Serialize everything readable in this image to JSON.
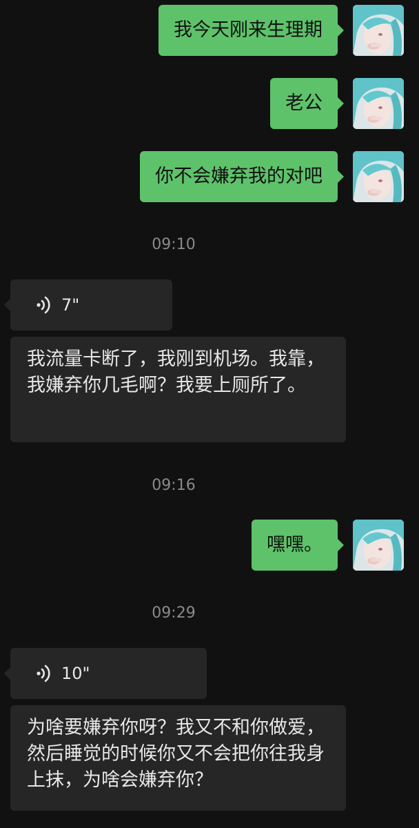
{
  "messages": {
    "out1": "我今天刚来生理期",
    "out2": "老公",
    "out3": "你不会嫌弃我的对吧",
    "out4": "嘿嘿。"
  },
  "timestamps": {
    "t1": "09:10",
    "t2": "09:16",
    "t3": "09:29"
  },
  "voice1": {
    "duration": "7\"",
    "transcript": "我流量卡断了，我刚到机场。我靠，我嫌弃你几毛啊？我要上厕所了。"
  },
  "voice2": {
    "duration": "10\"",
    "transcript": "为啥要嫌弃你呀？我又不和你做爱，然后睡觉的时候你又不会把你往我身上抹，为啥会嫌弃你？"
  },
  "colors": {
    "background": "#111111",
    "outgoing_bubble": "#5ec26a",
    "incoming_bubble": "#262626",
    "timestamp_text": "#8a8a8a"
  },
  "icons": {
    "avatar": "teal-haired-doll-avatar",
    "voice": "voice-wave-icon"
  }
}
